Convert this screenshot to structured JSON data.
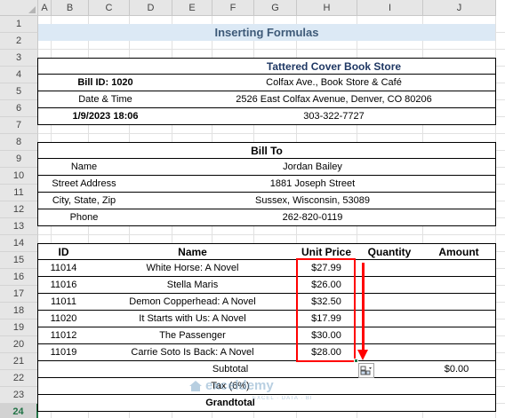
{
  "sheet": {
    "columns": [
      "A",
      "B",
      "C",
      "D",
      "E",
      "F",
      "G",
      "H",
      "I",
      "J"
    ],
    "rows": [
      "1",
      "2",
      "3",
      "4",
      "5",
      "6",
      "7",
      "8",
      "9",
      "10",
      "11",
      "12",
      "13",
      "14",
      "15",
      "16",
      "17",
      "18",
      "19",
      "20",
      "21",
      "22",
      "23",
      "24"
    ],
    "selected_row": "24"
  },
  "title": "Inserting Formulas",
  "store": {
    "name": "Tattered Cover Book Store",
    "bill_id": "Bill ID: 1020",
    "address": "Colfax Ave., Book Store & Café",
    "datetime_label": "Date & Time",
    "street": "2526 East Colfax Avenue, Denver, CO 80206",
    "datetime": "1/9/2023 18:06",
    "phone": "303-322-7727"
  },
  "bill_to": {
    "header": "Bill To",
    "name_label": "Name",
    "name": "Jordan Bailey",
    "street_label": "Street Address",
    "street": "1881 Joseph Street",
    "city_label": "City, State, Zip",
    "city": "Sussex, Wisconsin, 53089",
    "phone_label": "Phone",
    "phone": "262-820-0119"
  },
  "items_table": {
    "headers": {
      "id": "ID",
      "name": "Name",
      "unit_price": "Unit Price",
      "quantity": "Quantity",
      "amount": "Amount"
    },
    "rows": [
      {
        "id": "11014",
        "name": "White Horse: A Novel",
        "price": "$27.99"
      },
      {
        "id": "11016",
        "name": "Stella Maris",
        "price": "$26.00"
      },
      {
        "id": "11011",
        "name": "Demon Copperhead: A Novel",
        "price": "$32.50"
      },
      {
        "id": "11020",
        "name": "It Starts with Us: A Novel",
        "price": "$17.99"
      },
      {
        "id": "11012",
        "name": "The Passenger",
        "price": "$30.00"
      },
      {
        "id": "11019",
        "name": "Carrie Soto Is Back: A Novel",
        "price": "$28.00"
      }
    ],
    "subtotal_label": "Subtotal",
    "subtotal_value": "$0.00",
    "tax_label": "Tax (6%)",
    "grandtotal_label": "Grandtotal"
  },
  "watermark": {
    "text": "exceldemy",
    "sub": "EXCEL · DATA · BI"
  },
  "colors": {
    "highlight": "#ff0000",
    "title_bg": "#dce9f5",
    "accent": "#217346"
  }
}
